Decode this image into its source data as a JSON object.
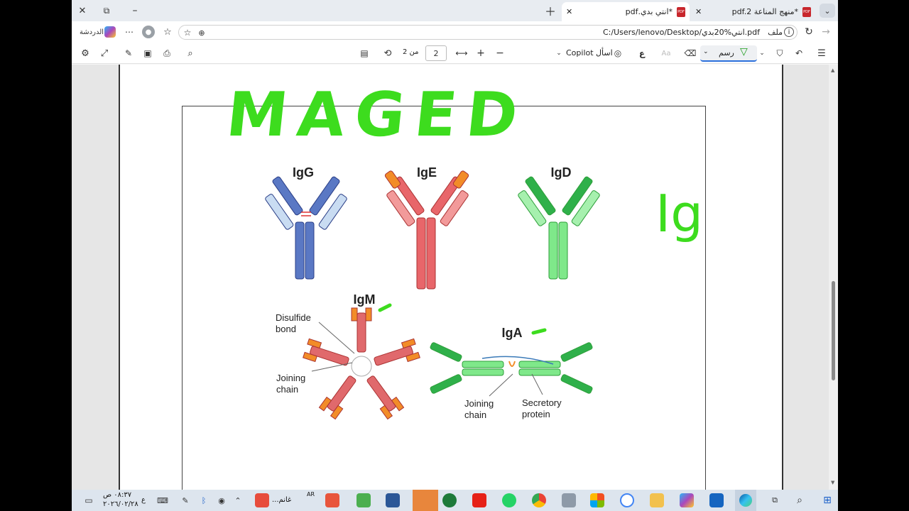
{
  "tabs": [
    {
      "label": "*منهج المناعة pdf.2"
    },
    {
      "label": "*انتي بدي.pdf"
    }
  ],
  "address": {
    "url": "C:/Users/lenovo/Desktop/انتي%20بدي.pdf",
    "file_label": "ملف",
    "chat_label": "الدردشة"
  },
  "toolbar": {
    "page_current": "2",
    "page_total": "من 2",
    "copilot": "اسأل Copilot",
    "draw": "رسم",
    "aa": "Aa",
    "read": "ع"
  },
  "document": {
    "handwriting_title": "MAGED",
    "handwriting_side": "Ig",
    "antibodies": [
      "IgG",
      "IgE",
      "IgD",
      "IgM",
      "IgA"
    ],
    "labels": {
      "disulfide": [
        "Disulfide",
        "bond"
      ],
      "joining_left": [
        "Joining",
        "chain"
      ],
      "joining_right": [
        "Joining",
        "chain"
      ],
      "secretory": [
        "Secretory",
        "protein"
      ]
    }
  },
  "taskbar": {
    "time": "٠٨:٣٧ ص",
    "date": "٢٠٢٦/٠٢/٢٨",
    "lang": "AR",
    "lang2": "ع",
    "app_label": "غانم..."
  },
  "colors": {
    "ink": "#3ddc1e",
    "igg": "#5a78c4",
    "ige": "#e8666a",
    "igd": "#6fe07a",
    "igm": "#e0696c"
  }
}
